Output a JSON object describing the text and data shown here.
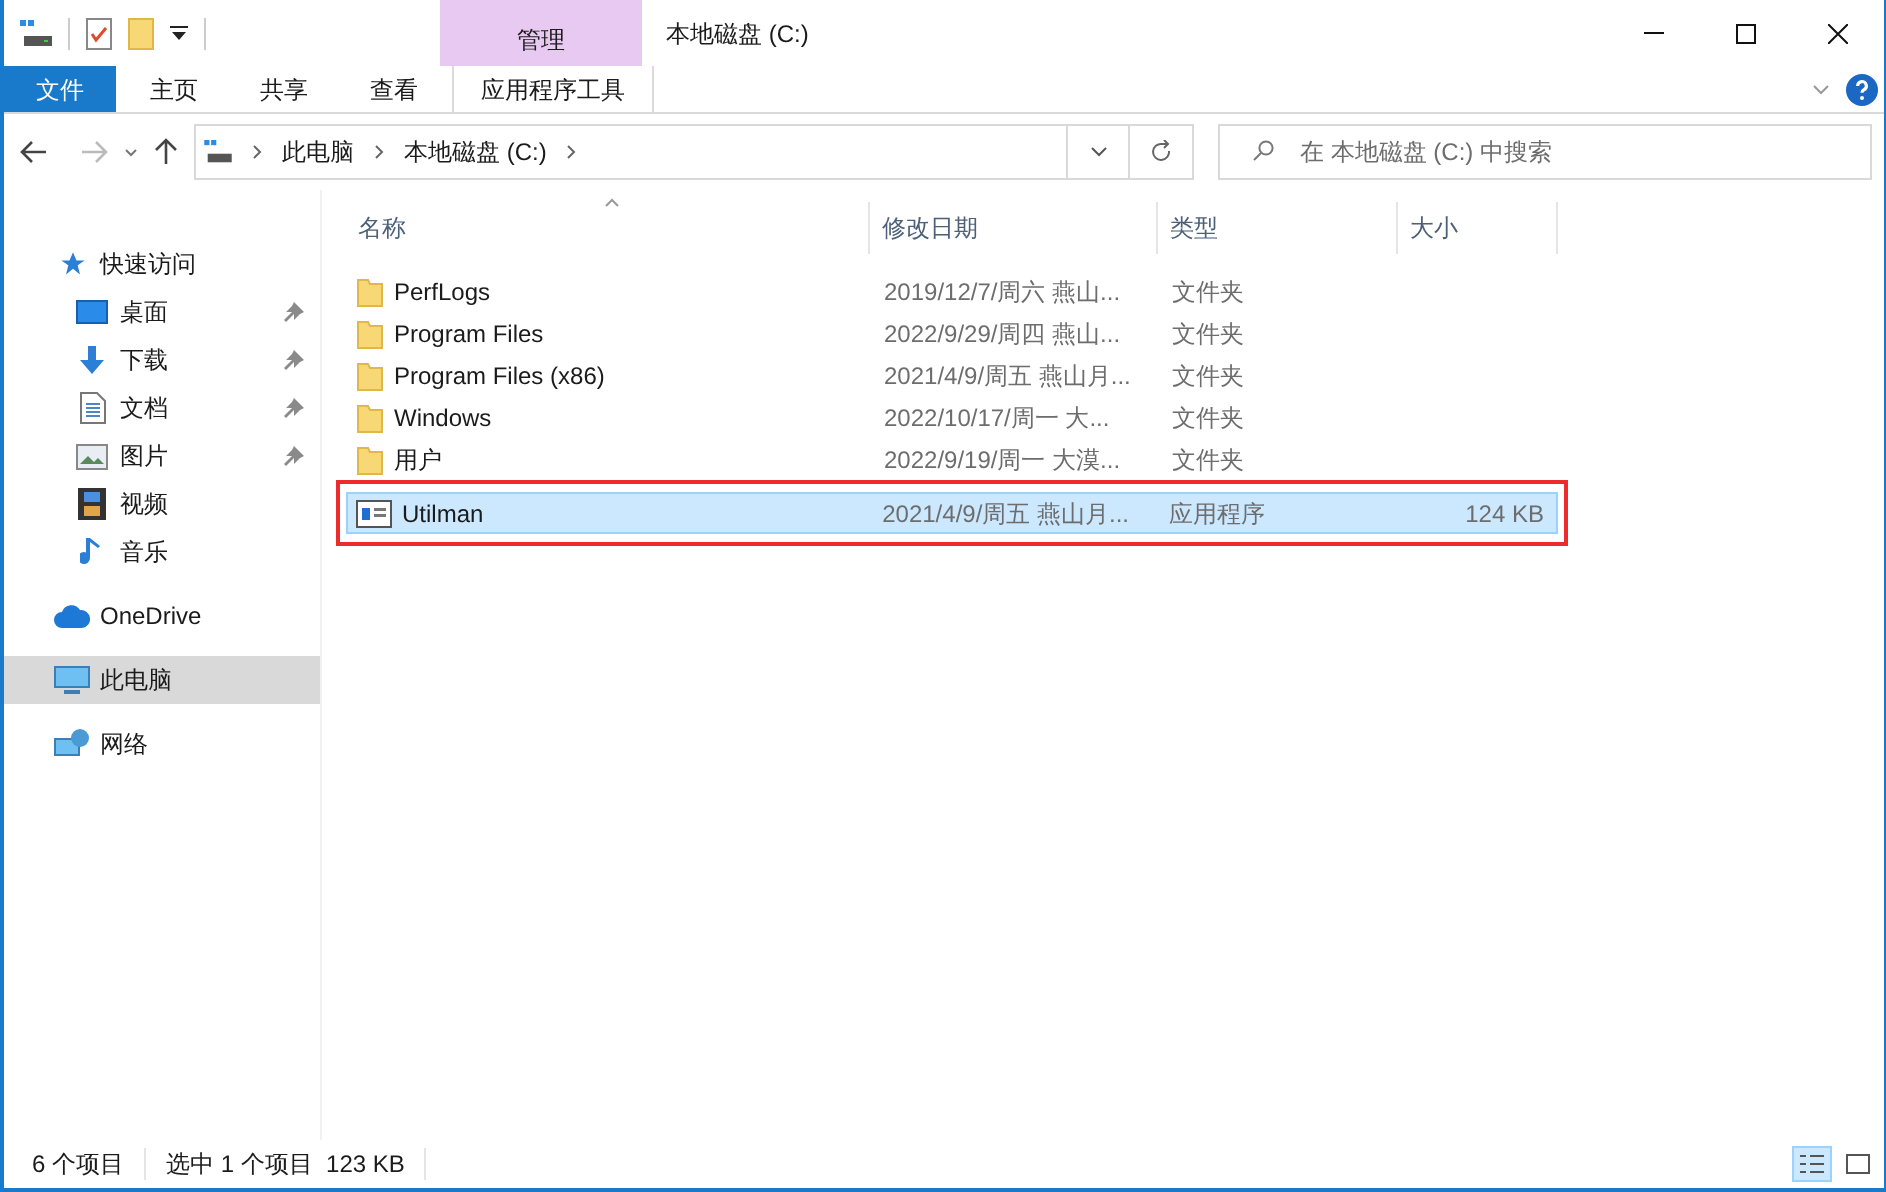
{
  "window": {
    "title": "本地磁盘 (C:)",
    "context_group": "管理"
  },
  "ribbon_tabs": [
    {
      "label": "文件",
      "kind": "file",
      "selected": false
    },
    {
      "label": "主页",
      "kind": "tab",
      "selected": false
    },
    {
      "label": "共享",
      "kind": "tab",
      "selected": false
    },
    {
      "label": "查看",
      "kind": "tab",
      "selected": false
    },
    {
      "label": "应用程序工具",
      "kind": "context",
      "selected": false
    }
  ],
  "breadcrumb": [
    "此电脑",
    "本地磁盘 (C:)"
  ],
  "search": {
    "placeholder": "在 本地磁盘 (C:) 中搜索"
  },
  "sidebar": {
    "items": [
      {
        "label": "快速访问",
        "kind": "star",
        "selected": false,
        "children": [
          {
            "label": "桌面",
            "kind": "desktop",
            "pinned": true,
            "selected": false
          },
          {
            "label": "下载",
            "kind": "download",
            "pinned": true,
            "selected": false
          },
          {
            "label": "文档",
            "kind": "document",
            "pinned": true,
            "selected": false
          },
          {
            "label": "图片",
            "kind": "image",
            "pinned": true,
            "selected": false
          },
          {
            "label": "视频",
            "kind": "video",
            "pinned": false,
            "selected": false
          },
          {
            "label": "音乐",
            "kind": "music",
            "pinned": false,
            "selected": false
          }
        ]
      },
      {
        "label": "OneDrive",
        "kind": "cloud",
        "selected": false
      },
      {
        "label": "此电脑",
        "kind": "computer",
        "selected": true
      },
      {
        "label": "网络",
        "kind": "network",
        "selected": false
      }
    ]
  },
  "table": {
    "columns": [
      "名称",
      "修改日期",
      "类型",
      "大小"
    ],
    "rows": [
      {
        "name": "PerfLogs",
        "kind": "folder",
        "date": "2019/12/7/周六 燕山...",
        "type": "文件夹",
        "selected": false,
        "annotated": false
      },
      {
        "name": "Program Files",
        "kind": "folder",
        "date": "2022/9/29/周四 燕山...",
        "type": "文件夹",
        "selected": false,
        "annotated": false
      },
      {
        "name": "Program Files (x86)",
        "kind": "folder",
        "date": "2021/4/9/周五 燕山月...",
        "type": "文件夹",
        "selected": false,
        "annotated": false
      },
      {
        "name": "Windows",
        "kind": "folder",
        "date": "2022/10/17/周一 大...",
        "type": "文件夹",
        "selected": false,
        "annotated": false
      },
      {
        "name": "用户",
        "kind": "folder",
        "date": "2022/9/19/周一 大漠...",
        "type": "文件夹",
        "selected": false,
        "annotated": false
      },
      {
        "name": "Utilman",
        "kind": "app",
        "date": "2021/4/9/周五 燕山月...",
        "type": "应用程序",
        "size": "124 KB",
        "selected": true,
        "annotated": true
      }
    ]
  },
  "status_bar": {
    "item_count": "6 个项目",
    "selection": "选中 1 个项目  123 KB"
  },
  "views": [
    {
      "kind": "details",
      "selected": true
    },
    {
      "kind": "large",
      "selected": false
    }
  ]
}
